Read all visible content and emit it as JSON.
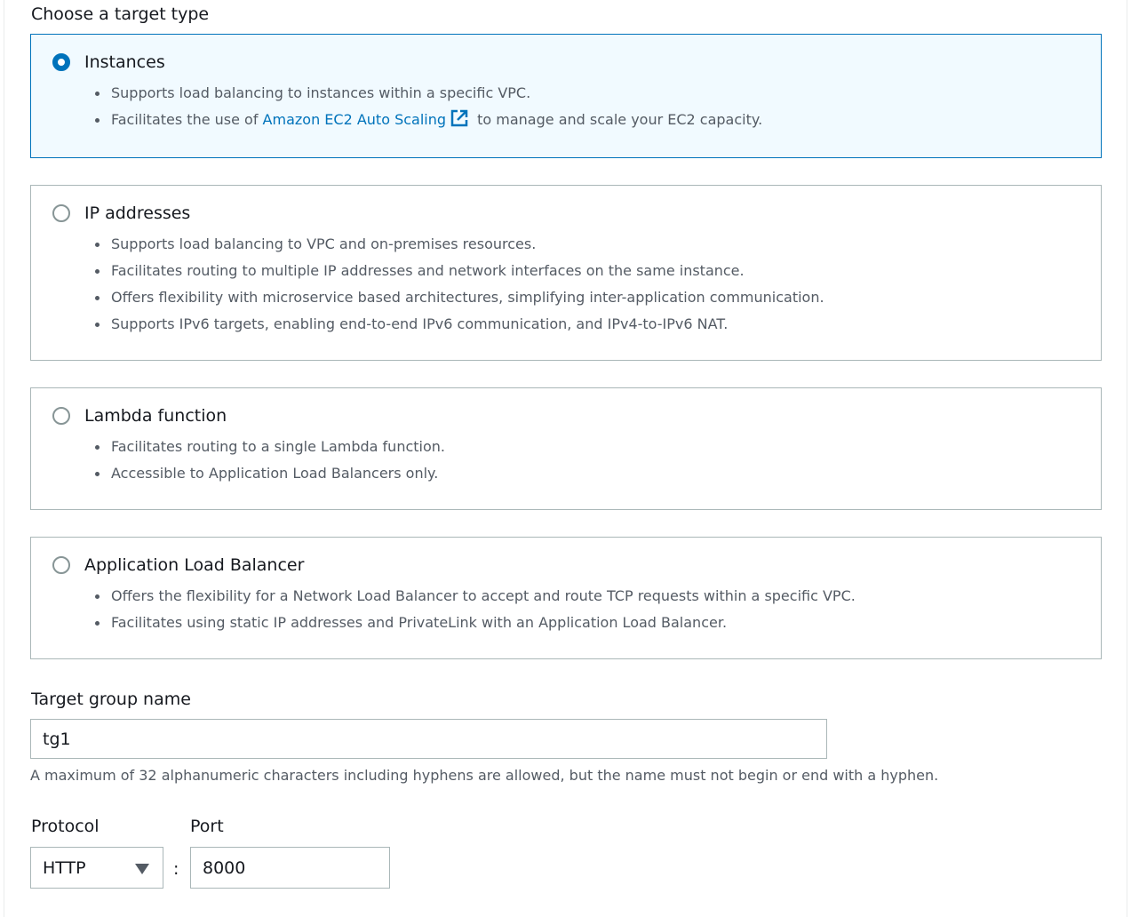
{
  "target_type": {
    "heading": "Choose a target type",
    "selected": "instances",
    "options": [
      {
        "id": "instances",
        "title": "Instances",
        "bullets": [
          "Supports load balancing to instances within a specific VPC."
        ],
        "link_bullet": {
          "prefix": "Facilitates the use of ",
          "link_text": "Amazon EC2 Auto Scaling",
          "suffix": " to manage and scale your EC2 capacity."
        }
      },
      {
        "id": "ip",
        "title": "IP addresses",
        "bullets": [
          "Supports load balancing to VPC and on-premises resources.",
          "Facilitates routing to multiple IP addresses and network interfaces on the same instance.",
          "Offers flexibility with microservice based architectures, simplifying inter-application communication.",
          "Supports IPv6 targets, enabling end-to-end IPv6 communication, and IPv4-to-IPv6 NAT."
        ]
      },
      {
        "id": "lambda",
        "title": "Lambda function",
        "bullets": [
          "Facilitates routing to a single Lambda function.",
          "Accessible to Application Load Balancers only."
        ]
      },
      {
        "id": "alb",
        "title": "Application Load Balancer",
        "bullets": [
          "Offers the flexibility for a Network Load Balancer to accept and route TCP requests within a specific VPC.",
          "Facilitates using static IP addresses and PrivateLink with an Application Load Balancer."
        ]
      }
    ]
  },
  "target_group_name": {
    "label": "Target group name",
    "value": "tg1",
    "constraint": "A maximum of 32 alphanumeric characters including hyphens are allowed, but the name must not begin or end with a hyphen."
  },
  "protocol": {
    "label": "Protocol",
    "value": "HTTP"
  },
  "separator": ":",
  "port": {
    "label": "Port",
    "value": "8000"
  },
  "colors": {
    "accent": "#0073bb",
    "selected_background": "#f1faff",
    "border": "#aab7b8",
    "secondary_text": "#545b64"
  },
  "icons": {
    "external_link": "external-link-icon",
    "dropdown": "caret-down-icon"
  }
}
